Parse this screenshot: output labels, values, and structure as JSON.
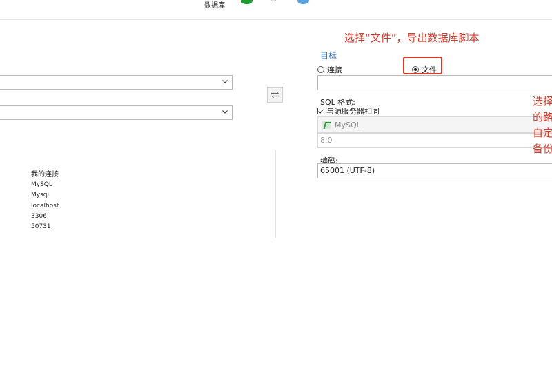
{
  "header": {
    "database_label": "数据库"
  },
  "colors": {
    "accent_blue": "#2f6fb5",
    "annotation_red": "#d63a2a",
    "source_db_green": "#1e9e2e",
    "target_db_blue": "#5ba3df"
  },
  "source": {
    "connection_select_value": "",
    "database_select_value": "",
    "connection_info": {
      "name": "我的连接",
      "type": "MySQL",
      "server": "Mysql",
      "host": "localhost",
      "port": "3306",
      "version": "50731"
    }
  },
  "target": {
    "title": "目标",
    "radio_connection_label": "连接",
    "radio_file_label": "文件",
    "selected": "文件",
    "file_path_value": "",
    "sql_format_label": "SQL 格式:",
    "same_as_source_label": "与源服务器相同",
    "same_as_source_checked": true,
    "sql_format_value": "MySQL",
    "sql_version_value": "8.0",
    "encoding_label": "编码:",
    "encoding_value": "65001 (UTF-8)"
  },
  "annotations": {
    "top": "选择“文件”，导出数据库脚本",
    "right_lines": [
      "选择",
      "的路",
      "自定",
      "备份"
    ]
  },
  "icons": {
    "source_db": "database-green-icon",
    "target_db": "database-blue-icon",
    "arrow": "arrow-right-icon",
    "swap": "swap-icon",
    "chevron": "chevron-down-icon",
    "mysql": "mysql-logo-icon"
  }
}
